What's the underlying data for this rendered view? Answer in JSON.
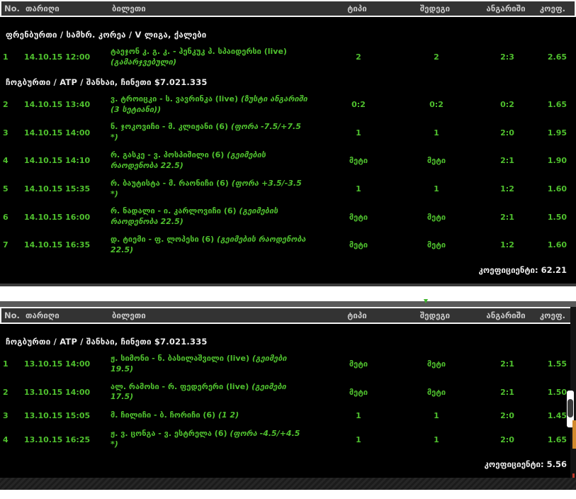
{
  "columns": [
    "No.",
    "თარიღი",
    "ბილეთი",
    "ტიპი",
    "შედეგი",
    "ანგარიში",
    "კოეფ."
  ],
  "colors": {
    "accent_green": "#4fc02e",
    "header_bg": "#333333",
    "header_text": "#c8c8c8",
    "table_bg": "#000000",
    "white_text": "#eaeaea",
    "gray_band": "#5a5a5a",
    "orange_edge": "#d18a2d"
  },
  "tables": [
    {
      "footer_label": "კოეფიციენტი:",
      "footer_value": "62.21",
      "groups": [
        {
          "header": "ფრენბურთი / სამხრ. კორეა / V ლიგა, ქალები",
          "rows": [
            {
              "no": "1",
              "date": "14.10.15 12:00",
              "ticket": "ტაეჯონ კ. გ. კ. - ჰენკუკ პ. სპაიდერსი (live)",
              "bet": "(გამარჯვებული)",
              "type": "2",
              "result": "2",
              "score": "2:3",
              "coef": "2.65"
            }
          ]
        },
        {
          "header": "ჩოგბურთი / ATP / შანხაი, ჩინეთი $7.021.335",
          "rows": [
            {
              "no": "2",
              "date": "14.10.15 13:40",
              "ticket": "ვ. ტროიცკი - ს. ვავრინკა (live)",
              "bet": "(ზუსტი ანგარიში (3 სეტიანი))",
              "type": "0:2",
              "result": "0:2",
              "score": "0:2",
              "coef": "1.65"
            },
            {
              "no": "3",
              "date": "14.10.15 14:00",
              "ticket": "ნ. ჯოკოვიჩი - მ. კლიჟანი (6)",
              "bet": "(ფორა -7.5/+7.5 *)",
              "type": "1",
              "result": "1",
              "score": "2:0",
              "coef": "1.95"
            },
            {
              "no": "4",
              "date": "14.10.15 14:10",
              "ticket": "რ. გასკე - ვ. პოსპიშილი (6)",
              "bet": "(გეიმების რაოდენობა 22.5)",
              "type": "მეტი",
              "result": "მეტი",
              "score": "2:1",
              "coef": "1.90"
            },
            {
              "no": "5",
              "date": "14.10.15 15:35",
              "ticket": "რ. ბაუტისტა - მ. რაონიჩი (6)",
              "bet": "(ფორა +3.5/-3.5 *)",
              "type": "1",
              "result": "1",
              "score": "1:2",
              "coef": "1.60"
            },
            {
              "no": "6",
              "date": "14.10.15 16:00",
              "ticket": "რ. ნადალი - ი. კარლოვიჩი (6)",
              "bet": "(გეიმების რაოდენობა 22.5)",
              "type": "მეტი",
              "result": "მეტი",
              "score": "2:1",
              "coef": "1.50"
            },
            {
              "no": "7",
              "date": "14.10.15 16:35",
              "ticket": "დ. ტიემი - ფ. ლოპესი (6)",
              "bet": "(გეიმების რაოდენობა 22.5)",
              "type": "მეტი",
              "result": "მეტი",
              "score": "1:2",
              "coef": "1.60"
            }
          ]
        }
      ]
    },
    {
      "footer_label": "კოეფიციენტი:",
      "footer_value": "5.56",
      "groups": [
        {
          "header": "ჩოგბურთი / ATP / შანხაი, ჩინეთი $7.021.335",
          "rows": [
            {
              "no": "1",
              "date": "13.10.15 14:00",
              "ticket": "ჟ. სიმონი - ნ. ბასილაშვილი (live)",
              "bet": "(გეიმები 19.5)",
              "type": "მეტი",
              "result": "მეტი",
              "score": "2:1",
              "coef": "1.55"
            },
            {
              "no": "2",
              "date": "13.10.15 14:00",
              "ticket": "ალ. რამოსი - რ. ფედერერი (live)",
              "bet": "(გეიმები 17.5)",
              "type": "მეტი",
              "result": "მეტი",
              "score": "2:1",
              "coef": "1.50"
            },
            {
              "no": "3",
              "date": "13.10.15 15:05",
              "ticket": "მ. ჩილიჩი - ბ. ჩორიჩი (6)",
              "bet": "(1 2)",
              "type": "1",
              "result": "1",
              "score": "2:0",
              "coef": "1.45"
            },
            {
              "no": "4",
              "date": "13.10.15 16:25",
              "ticket": "ჟ. ვ. ცონგა - ვ. ესტრელა (6)",
              "bet": "(ფორა -4.5/+4.5 *)",
              "type": "1",
              "result": "1",
              "score": "2:0",
              "coef": "1.65"
            }
          ]
        }
      ]
    }
  ]
}
